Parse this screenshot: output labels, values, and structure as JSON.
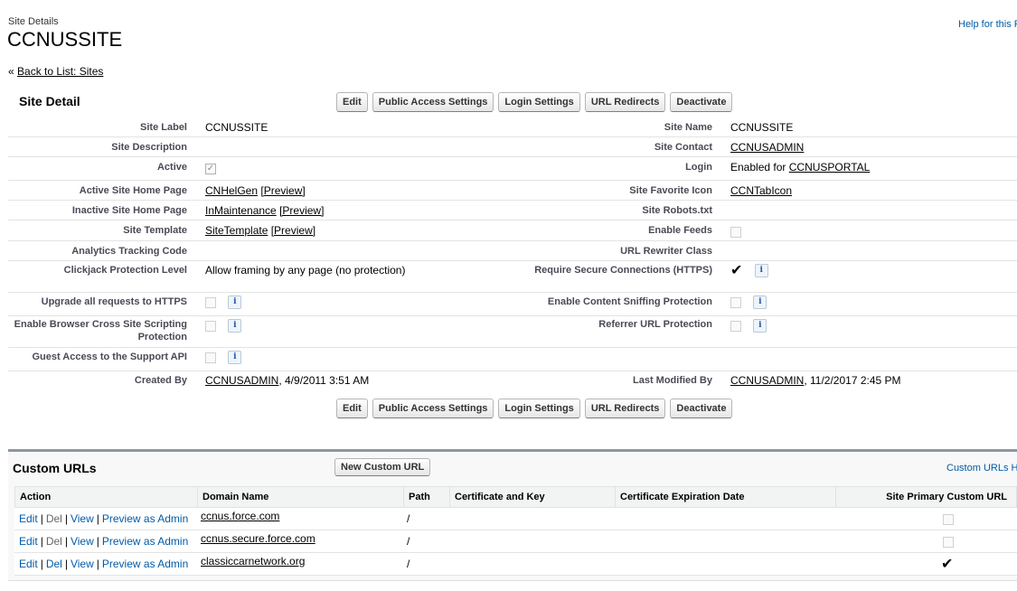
{
  "header": {
    "breadcrumb": "Site Details",
    "title": "CCNUSSITE",
    "help_link": "Help for this Page",
    "back_prefix": "«",
    "back_link": "Back to List: Sites"
  },
  "detail": {
    "section_title": "Site Detail",
    "buttons": {
      "edit": "Edit",
      "public_access": "Public Access Settings",
      "login_settings": "Login Settings",
      "url_redirects": "URL Redirects",
      "deactivate": "Deactivate"
    },
    "fields": {
      "site_label": {
        "label": "Site Label",
        "value": "CCNUSSITE"
      },
      "site_name": {
        "label": "Site Name",
        "value": "CCNUSSITE"
      },
      "site_description": {
        "label": "Site Description",
        "value": ""
      },
      "site_contact": {
        "label": "Site Contact",
        "value": "CCNUSADMIN"
      },
      "active": {
        "label": "Active",
        "checked": true
      },
      "login": {
        "label": "Login",
        "prefix": "Enabled for",
        "value": "CCNUSPORTAL"
      },
      "active_home": {
        "label": "Active Site Home Page",
        "value": "CNHelGen",
        "preview": "[Preview]"
      },
      "favorite_icon": {
        "label": "Site Favorite Icon",
        "value": "CCNTabIcon"
      },
      "inactive_home": {
        "label": "Inactive Site Home Page",
        "value": "InMaintenance",
        "preview": "[Preview]"
      },
      "robots": {
        "label": "Site Robots.txt",
        "value": ""
      },
      "template": {
        "label": "Site Template",
        "value": "SiteTemplate",
        "preview": "[Preview]"
      },
      "enable_feeds": {
        "label": "Enable Feeds",
        "checked": false
      },
      "analytics": {
        "label": "Analytics Tracking Code",
        "value": ""
      },
      "url_rewriter": {
        "label": "URL Rewriter Class",
        "value": ""
      },
      "clickjack": {
        "label": "Clickjack Protection Level",
        "value": "Allow framing by any page (no protection)"
      },
      "secure_conn": {
        "label": "Require Secure Connections (HTTPS)",
        "checked": true
      },
      "upgrade_https": {
        "label": "Upgrade all requests to HTTPS",
        "checked": false
      },
      "content_sniff": {
        "label": "Enable Content Sniffing Protection",
        "checked": false
      },
      "xss": {
        "label": "Enable Browser Cross Site Scripting Protection",
        "checked": false
      },
      "referrer": {
        "label": "Referrer URL Protection",
        "checked": false
      },
      "guest_api": {
        "label": "Guest Access to the Support API",
        "checked": false
      },
      "created_by": {
        "label": "Created By",
        "user": "CCNUSADMIN",
        "date": ", 4/9/2011 3:51 AM"
      },
      "modified_by": {
        "label": "Last Modified By",
        "user": "CCNUSADMIN",
        "date": ", 11/2/2017 2:45 PM"
      }
    },
    "info_glyph": "i",
    "check_glyph": "✓",
    "checkmark_glyph": "✔"
  },
  "custom_urls": {
    "title": "Custom URLs",
    "new_button": "New Custom URL",
    "help_link": "Custom URLs Help",
    "columns": {
      "action": "Action",
      "domain": "Domain Name",
      "path": "Path",
      "cert": "Certificate and Key",
      "expiry": "Certificate Expiration Date",
      "primary": "Site Primary Custom URL"
    },
    "actions": {
      "edit": "Edit",
      "del": "Del",
      "view": "View",
      "preview": "Preview as Admin",
      "sep": "|"
    },
    "rows": [
      {
        "domain": "ccnus.force.com",
        "path": "/",
        "del_enabled": false,
        "primary": false
      },
      {
        "domain": "ccnus.secure.force.com",
        "path": "/",
        "del_enabled": false,
        "primary": false
      },
      {
        "domain": "classiccarnetwork.org",
        "path": "/",
        "del_enabled": true,
        "primary": true
      }
    ]
  }
}
